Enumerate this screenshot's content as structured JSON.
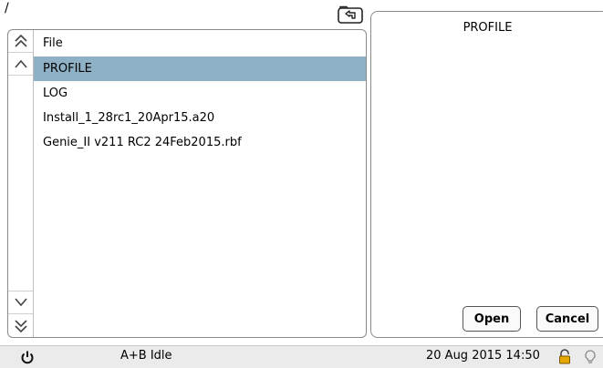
{
  "header": {
    "path": "/"
  },
  "icons": {
    "up_folder": "folder-up-icon",
    "scroll_top": "double-chevron-up-icon",
    "scroll_up": "chevron-up-icon",
    "scroll_down": "chevron-down-icon",
    "scroll_bottom": "double-chevron-down-icon",
    "power": "power-icon",
    "lock": "lock-icon",
    "bulb": "bulb-icon"
  },
  "file_list": {
    "header": "File",
    "items": [
      {
        "name": "PROFILE",
        "selected": true
      },
      {
        "name": "LOG",
        "selected": false
      },
      {
        "name": "Install_1_28rc1_20Apr15.a20",
        "selected": false
      },
      {
        "name": "Genie_II v211 RC2 24Feb2015.rbf",
        "selected": false
      }
    ]
  },
  "preview": {
    "title": "PROFILE",
    "open_label": "Open",
    "cancel_label": "Cancel"
  },
  "status_bar": {
    "status": "A+B Idle",
    "datetime": "20 Aug 2015 14:50"
  },
  "colors": {
    "selection": "#8fb1c5",
    "panel_border": "#8a8a8a",
    "status_bg": "#ebebeb",
    "lock_accent": "#e6a800"
  }
}
